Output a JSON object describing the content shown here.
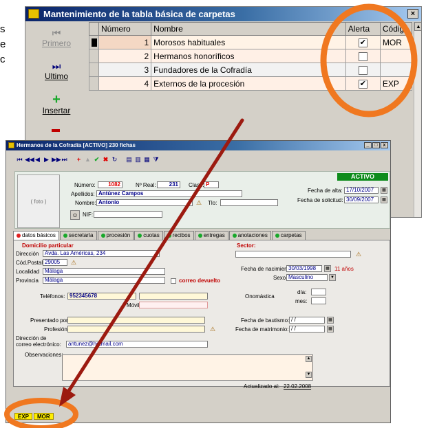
{
  "side_text": [
    "s",
    "e",
    "c"
  ],
  "back_window": {
    "title": "Mantenimiento de la tabla básica de carpetas",
    "close_glyph": "×",
    "nav": [
      {
        "label": "Primero",
        "glyph": "⏮",
        "disabled": true
      },
      {
        "label": "Ultimo",
        "glyph": "⏭",
        "disabled": false
      },
      {
        "label": "Insertar",
        "glyph": "+",
        "disabled": false
      }
    ],
    "columns": [
      "Número",
      "Nombre",
      "Alerta",
      "Código"
    ],
    "rows": [
      {
        "numero": "1",
        "nombre": "Morosos habituales",
        "alerta": true,
        "codigo": "MOR"
      },
      {
        "numero": "2",
        "nombre": "Hermanos honoríficos",
        "alerta": false,
        "codigo": ""
      },
      {
        "numero": "3",
        "nombre": "Fundadores de la Cofradía",
        "alerta": false,
        "codigo": ""
      },
      {
        "numero": "4",
        "nombre": "Externos de la procesión",
        "alerta": true,
        "codigo": "EXP"
      }
    ]
  },
  "front_window": {
    "title": "Hermanos de la Cofradía [ACTIVO] 230 fichas",
    "status_badge": "ACTIVO",
    "foto_placeholder": "( foto )",
    "labels": {
      "numero": "Número:",
      "n_real": "Nº Real:",
      "clase": "Clase:",
      "apellidos": "Apellidos:",
      "nombre": "Nombre:",
      "tlo": "Tlo:",
      "nif": "NIF:",
      "fecha_alta": "Fecha de alta:",
      "fecha_solicitud": "Fecha de solicitud:"
    },
    "values": {
      "numero": "1082",
      "n_real": "231",
      "clase": "P",
      "apellidos": "Antúnez Campos",
      "nombre": "Antonio",
      "fecha_alta": "17/10/2007",
      "fecha_solicitud": "30/09/2007"
    },
    "tabs": [
      {
        "label": "datos básicos",
        "active": true,
        "dot": "red"
      },
      {
        "label": "secretaría",
        "active": false,
        "dot": "green"
      },
      {
        "label": "procesión",
        "active": false,
        "dot": "green"
      },
      {
        "label": "cuotas",
        "active": false,
        "dot": "green"
      },
      {
        "label": "recibos",
        "active": false,
        "dot": "green"
      },
      {
        "label": "entregas",
        "active": false,
        "dot": "green"
      },
      {
        "label": "anotaciones",
        "active": false,
        "dot": "green"
      },
      {
        "label": "carpetas",
        "active": false,
        "dot": "green"
      }
    ],
    "domicilio": {
      "section_title": "Domicilio particular",
      "direccion_label": "Dirección",
      "direccion": "Avda. Las Américas, 234",
      "codpostal_label": "Cód.Postal",
      "codpostal": "29005",
      "localidad_label": "Localidad",
      "localidad": "Málaga",
      "provincia_label": "Provincia",
      "provincia": "Málaga",
      "correo_devuelto": "correo devuelto"
    },
    "sector": {
      "label": "Sector:",
      "fecha_nac_label": "Fecha de nacimiento:",
      "fecha_nac": "30/03/1998",
      "edad": "11 años",
      "sexo_label": "Sexo:",
      "sexo": "Masculino",
      "onomastica_label": "Onomástica",
      "dia_label": "día:",
      "mes_label": "mes:",
      "bautismo_label": "Fecha de bautismo:",
      "bautismo": " / /",
      "matrimonio_label": "Fecha de matrimonio:",
      "matrimonio": " / /"
    },
    "contacto": {
      "telefonos_label": "Teléfonos:",
      "telefono": "952345678",
      "movil_label": "Móvil",
      "presentado_label": "Presentado por:",
      "profesion_label": "Profesión:",
      "email_label_1": "Dirección de",
      "email_label_2": "correo electrónico:",
      "email": "antunez@hotmail.com",
      "observaciones_label": "Observaciones:",
      "actualizado_label": "Actualizado al:",
      "actualizado": "22.02.2008"
    },
    "status_chips": [
      "EXP",
      "MOR"
    ]
  },
  "colors": {
    "highlight_ring": "#f07820",
    "arrow": "#9c1a10",
    "titlebar": "#0a246a",
    "activo": "#0e8c1c",
    "chip": "#ffee00"
  }
}
